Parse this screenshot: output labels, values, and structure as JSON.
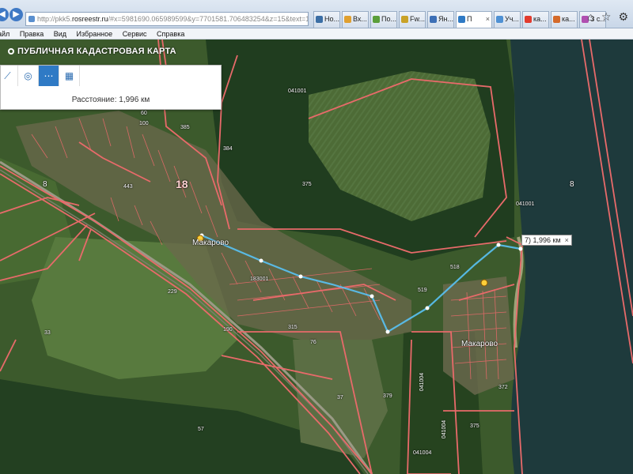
{
  "browser": {
    "address": "http://pkk5.rosreestr.ru/#x=5981690.065989599&y=7701581.706483254&z=15&text=18%3A0",
    "address_prefix": "http://pkk5.",
    "address_host": "rosreestr.ru",
    "address_rest": "/#x=5981690.065989599&y=7701581.706483254&z=15&text=18%3A0",
    "tabs": [
      {
        "label": "Но...",
        "color": "#3b6ea5"
      },
      {
        "label": "Вх...",
        "color": "#e0a030"
      },
      {
        "label": "По...",
        "color": "#5a9e3a"
      },
      {
        "label": "Fw...",
        "color": "#c9a227"
      },
      {
        "label": "Ян...",
        "color": "#3d6fb6"
      },
      {
        "label": "П",
        "color": "#2f7ac5",
        "active": true,
        "close": "×"
      },
      {
        "label": "Уч...",
        "color": "#4f91d4"
      },
      {
        "label": "ка...",
        "color": "#e23b2e"
      },
      {
        "label": "ка...",
        "color": "#d46a2a"
      },
      {
        "label": "З с...",
        "color": "#b04fb0"
      }
    ],
    "window_controls": [
      "⌂",
      "☆",
      "⚙"
    ]
  },
  "menu": [
    "айл",
    "Правка",
    "Вид",
    "Избранное",
    "Сервис",
    "Справка"
  ],
  "app": {
    "title": "ПУБЛИЧНАЯ КАДАСТРОВАЯ КАРТА"
  },
  "measure": {
    "tools": [
      {
        "icon": "ruler-icon",
        "glyph": "⟋"
      },
      {
        "icon": "point-icon",
        "glyph": "◎"
      },
      {
        "icon": "distance-icon",
        "glyph": "⋯",
        "active": true
      },
      {
        "icon": "area-icon",
        "glyph": "▦"
      }
    ],
    "distance_text": "Расстояние: 1,996 км"
  },
  "popup": {
    "text": "7) 1,996 км",
    "close": "×"
  },
  "map_labels": {
    "big_18": "18",
    "q_8": "8",
    "q_8_left": "8",
    "n_041001_top": "041001",
    "n_041001_right": "041001",
    "n_183001": "183001",
    "town_1": "Макарово",
    "town_2": "Макарово",
    "n_375": "375",
    "n_60": "60",
    "n_100": "100",
    "n_385": "385",
    "n_384": "384",
    "n_443": "443",
    "n_229": "229",
    "n_33": "33",
    "n_315": "315",
    "n_37": "37",
    "n_379": "379",
    "n_372": "372",
    "n_375b": "375",
    "n_518": "518",
    "n_57": "57",
    "n_190": "190",
    "n_76": "76",
    "n_519": "519",
    "v_041004_a": "041004",
    "v_041004_b": "041004",
    "n_041004_c": "041004"
  },
  "colors": {
    "boundary": "#e86a6a",
    "route": "#59c2f5",
    "water": "#203c3f",
    "forest": "#1f3b1e",
    "field": "#4a6a34"
  }
}
